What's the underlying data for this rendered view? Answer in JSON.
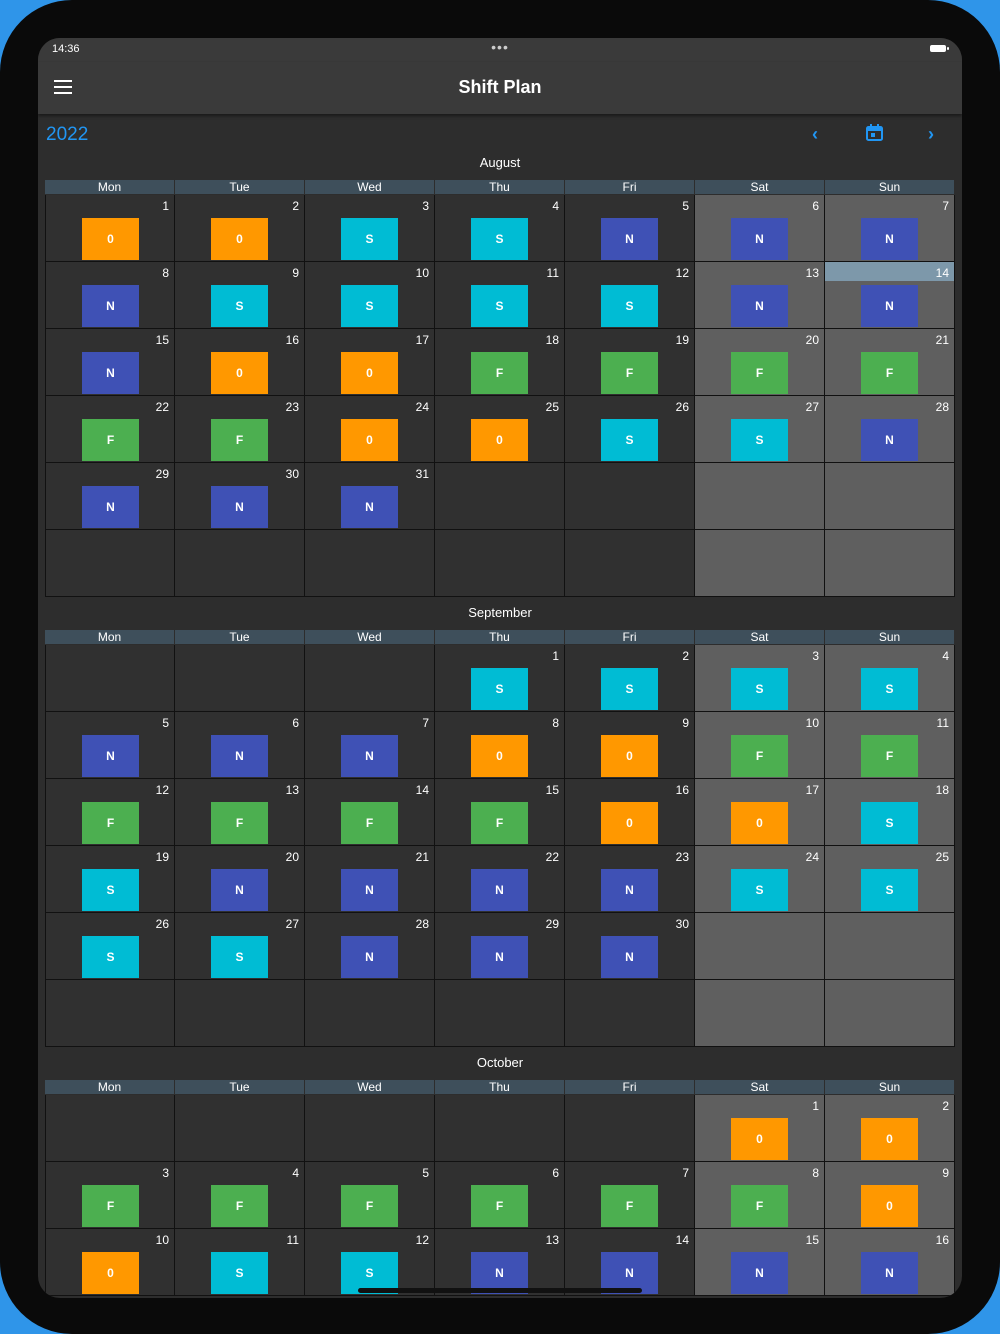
{
  "status_bar": {
    "time": "14:36",
    "dots": "•••"
  },
  "app_bar": {
    "title": "Shift Plan",
    "menu_icon": "hamburger-menu-icon"
  },
  "nav": {
    "year": "2022",
    "prev_icon": "chevron-left-icon",
    "today_icon": "calendar-icon",
    "next_icon": "chevron-right-icon",
    "prev_glyph": "‹",
    "next_glyph": "›"
  },
  "weekdays": [
    "Mon",
    "Tue",
    "Wed",
    "Thu",
    "Fri",
    "Sat",
    "Sun"
  ],
  "shift_colors": {
    "0": "#ff9800",
    "S": "#00bcd4",
    "N": "#3f51b5",
    "F": "#4caf50"
  },
  "months": [
    {
      "name": "August",
      "weeks": [
        [
          {
            "day": "1",
            "shift": "0"
          },
          {
            "day": "2",
            "shift": "0"
          },
          {
            "day": "3",
            "shift": "S"
          },
          {
            "day": "4",
            "shift": "S"
          },
          {
            "day": "5",
            "shift": "N"
          },
          {
            "day": "6",
            "shift": "N"
          },
          {
            "day": "7",
            "shift": "N"
          }
        ],
        [
          {
            "day": "8",
            "shift": "N"
          },
          {
            "day": "9",
            "shift": "S"
          },
          {
            "day": "10",
            "shift": "S"
          },
          {
            "day": "11",
            "shift": "S"
          },
          {
            "day": "12",
            "shift": "S"
          },
          {
            "day": "13",
            "shift": "N"
          },
          {
            "day": "14",
            "shift": "N",
            "today": true
          }
        ],
        [
          {
            "day": "15",
            "shift": "N"
          },
          {
            "day": "16",
            "shift": "0"
          },
          {
            "day": "17",
            "shift": "0"
          },
          {
            "day": "18",
            "shift": "F"
          },
          {
            "day": "19",
            "shift": "F"
          },
          {
            "day": "20",
            "shift": "F"
          },
          {
            "day": "21",
            "shift": "F"
          }
        ],
        [
          {
            "day": "22",
            "shift": "F"
          },
          {
            "day": "23",
            "shift": "F"
          },
          {
            "day": "24",
            "shift": "0"
          },
          {
            "day": "25",
            "shift": "0"
          },
          {
            "day": "26",
            "shift": "S"
          },
          {
            "day": "27",
            "shift": "S"
          },
          {
            "day": "28",
            "shift": "N"
          }
        ],
        [
          {
            "day": "29",
            "shift": "N"
          },
          {
            "day": "30",
            "shift": "N"
          },
          {
            "day": "31",
            "shift": "N"
          },
          {},
          {},
          {},
          {}
        ],
        [
          {},
          {},
          {},
          {},
          {},
          {},
          {}
        ]
      ]
    },
    {
      "name": "September",
      "weeks": [
        [
          {},
          {},
          {},
          {
            "day": "1",
            "shift": "S"
          },
          {
            "day": "2",
            "shift": "S"
          },
          {
            "day": "3",
            "shift": "S"
          },
          {
            "day": "4",
            "shift": "S"
          }
        ],
        [
          {
            "day": "5",
            "shift": "N"
          },
          {
            "day": "6",
            "shift": "N"
          },
          {
            "day": "7",
            "shift": "N"
          },
          {
            "day": "8",
            "shift": "0"
          },
          {
            "day": "9",
            "shift": "0"
          },
          {
            "day": "10",
            "shift": "F"
          },
          {
            "day": "11",
            "shift": "F"
          }
        ],
        [
          {
            "day": "12",
            "shift": "F"
          },
          {
            "day": "13",
            "shift": "F"
          },
          {
            "day": "14",
            "shift": "F"
          },
          {
            "day": "15",
            "shift": "F"
          },
          {
            "day": "16",
            "shift": "0"
          },
          {
            "day": "17",
            "shift": "0"
          },
          {
            "day": "18",
            "shift": "S"
          }
        ],
        [
          {
            "day": "19",
            "shift": "S"
          },
          {
            "day": "20",
            "shift": "N"
          },
          {
            "day": "21",
            "shift": "N"
          },
          {
            "day": "22",
            "shift": "N"
          },
          {
            "day": "23",
            "shift": "N"
          },
          {
            "day": "24",
            "shift": "S"
          },
          {
            "day": "25",
            "shift": "S"
          }
        ],
        [
          {
            "day": "26",
            "shift": "S"
          },
          {
            "day": "27",
            "shift": "S"
          },
          {
            "day": "28",
            "shift": "N"
          },
          {
            "day": "29",
            "shift": "N"
          },
          {
            "day": "30",
            "shift": "N"
          },
          {},
          {}
        ],
        [
          {},
          {},
          {},
          {},
          {},
          {},
          {}
        ]
      ]
    },
    {
      "name": "October",
      "weeks": [
        [
          {},
          {},
          {},
          {},
          {},
          {
            "day": "1",
            "shift": "0"
          },
          {
            "day": "2",
            "shift": "0"
          }
        ],
        [
          {
            "day": "3",
            "shift": "F"
          },
          {
            "day": "4",
            "shift": "F"
          },
          {
            "day": "5",
            "shift": "F"
          },
          {
            "day": "6",
            "shift": "F"
          },
          {
            "day": "7",
            "shift": "F"
          },
          {
            "day": "8",
            "shift": "F"
          },
          {
            "day": "9",
            "shift": "0"
          }
        ],
        [
          {
            "day": "10",
            "shift": "0"
          },
          {
            "day": "11",
            "shift": "S"
          },
          {
            "day": "12",
            "shift": "S"
          },
          {
            "day": "13",
            "shift": "N"
          },
          {
            "day": "14",
            "shift": "N"
          },
          {
            "day": "15",
            "shift": "N"
          },
          {
            "day": "16",
            "shift": "N"
          }
        ]
      ]
    }
  ]
}
